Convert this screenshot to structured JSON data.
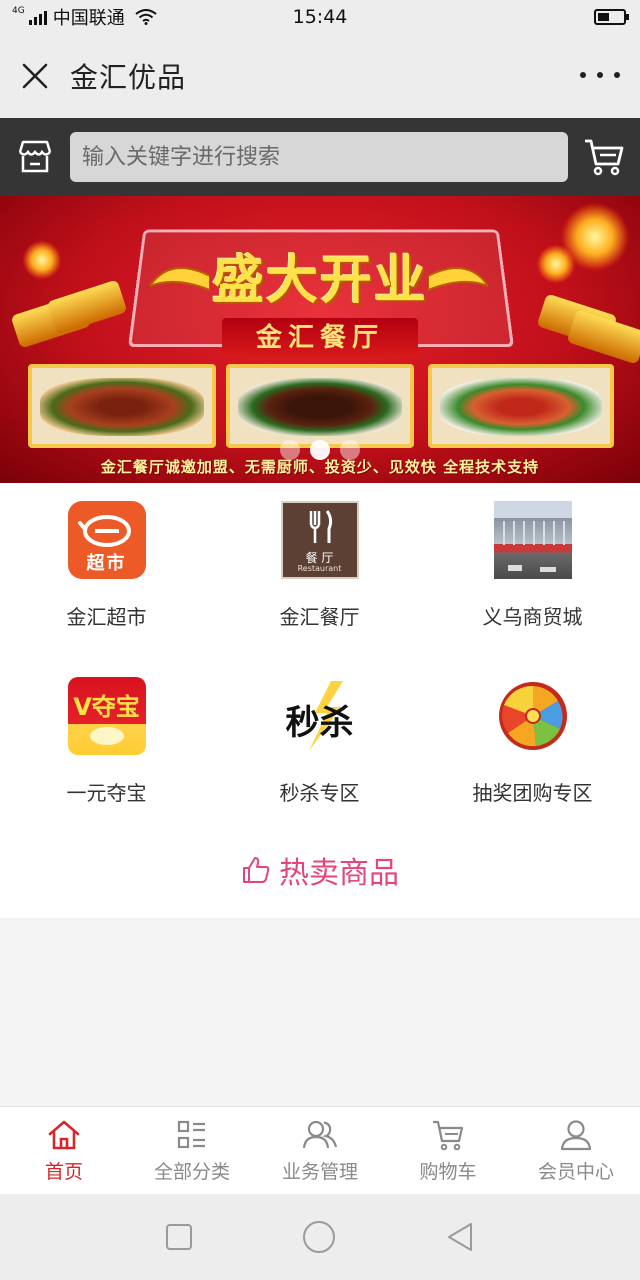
{
  "status_bar": {
    "network": "4G",
    "carrier": "中国联通",
    "time": "15:44",
    "battery_level": 0.45
  },
  "header": {
    "title": "金汇优品",
    "close_icon": "close-icon",
    "more_icon": "more-icon"
  },
  "search": {
    "placeholder": "输入关键字进行搜索",
    "left_icon": "shop-icon",
    "right_icon": "cart-icon"
  },
  "banner": {
    "headline": "盛大开业",
    "subtitle": "金汇餐厅",
    "slogan": "金汇餐厅诚邀加盟、无需厨师、投资少、见效快 全程技术支持",
    "dots": 3,
    "active_dot": 1
  },
  "categories": [
    {
      "label": "金汇超市",
      "icon": "supermarket-icon"
    },
    {
      "label": "金汇餐厅",
      "icon": "restaurant-icon",
      "icon_text": "餐 厅",
      "icon_subtext": "Restaurant"
    },
    {
      "label": "义乌商贸城",
      "icon": "market-building-icon"
    },
    {
      "label": "一元夺宝",
      "icon": "treasure-icon",
      "icon_text": "V夺宝"
    },
    {
      "label": "秒杀专区",
      "icon": "flash-sale-icon",
      "icon_text": "秒杀"
    },
    {
      "label": "抽奖团购专区",
      "icon": "lottery-wheel-icon"
    }
  ],
  "supermarket_icon_text": "超市",
  "hot_section": {
    "title": "热卖商品",
    "icon": "thumbs-up-icon"
  },
  "bottom_nav": [
    {
      "label": "首页",
      "icon": "home-icon",
      "active": true
    },
    {
      "label": "全部分类",
      "icon": "category-list-icon",
      "active": false
    },
    {
      "label": "业务管理",
      "icon": "users-icon",
      "active": false
    },
    {
      "label": "购物车",
      "icon": "cart-icon",
      "active": false
    },
    {
      "label": "会员中心",
      "icon": "user-icon",
      "active": false
    }
  ],
  "colors": {
    "accent": "#d7262b",
    "hot_pink": "#e5457a",
    "search_bar_bg": "#353535",
    "banner_red": "#c0101a"
  }
}
